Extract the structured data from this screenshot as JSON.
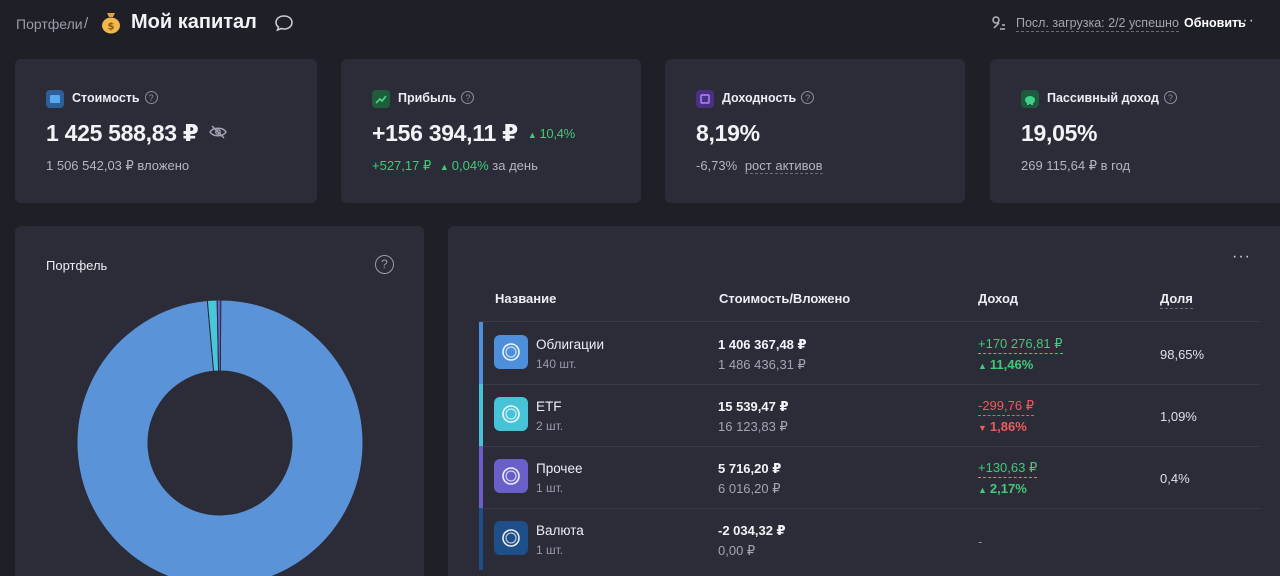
{
  "header": {
    "breadcrumb": "Портфели",
    "separator": "/",
    "title": "Мой капитал",
    "sync_status": "Посл. загрузка: 2/2 успешно",
    "refresh_label": "Обновить",
    "more": "···"
  },
  "cards": [
    {
      "label": "Стоимость",
      "value": "1 425 588,83 ₽",
      "sub": "1 506 542,03 ₽ вложено",
      "icon": "wallet-icon",
      "color": "#3d8de0"
    },
    {
      "label": "Прибыль",
      "value": "+156 394,11 ₽",
      "change_pct": "10,4%",
      "sub_amount": "+527,17 ₽",
      "sub_pct": "0,04%",
      "sub_suffix": "за день",
      "icon": "chart-line-icon",
      "color": "#2f8f5b"
    },
    {
      "label": "Доходность",
      "value": "8,19%",
      "sub_pct": "-6,73%",
      "sub_link": "рост активов",
      "icon": "calendar-icon",
      "color": "#7b52c9"
    },
    {
      "label": "Пассивный доход",
      "value": "19,05%",
      "sub": "269 115,64 ₽ в год",
      "icon": "piggy-bank-icon",
      "color": "#2a9d6a"
    }
  ],
  "portfolio": {
    "title": "Портфель",
    "help": "?"
  },
  "chart_data": {
    "type": "pie",
    "donut": true,
    "categories": [
      "Облигации",
      "ETF",
      "Прочее",
      "Валюта"
    ],
    "values": [
      98.65,
      1.09,
      0.4,
      0
    ],
    "colors": [
      "#5b93d8",
      "#48c6da",
      "#6a5fc9",
      "#1f4f88"
    ]
  },
  "table": {
    "headers": {
      "name": "Название",
      "value": "Стоимость/Вложено",
      "income": "Доход",
      "share": "Доля"
    },
    "more": "···",
    "rows": [
      {
        "name": "Облигации",
        "qty": "140 шт.",
        "value": "1 406 367,48 ₽",
        "invested": "1 486 436,31 ₽",
        "income": "+170 276,81 ₽",
        "income_pct": "11,46%",
        "trend": "up",
        "share": "98,65%",
        "color": "#4e8fdc"
      },
      {
        "name": "ETF",
        "qty": "2 шт.",
        "value": "15 539,47 ₽",
        "invested": "16 123,83 ₽",
        "income": "-299,76 ₽",
        "income_pct": "1,86%",
        "trend": "down",
        "share": "1,09%",
        "color": "#46c3d6"
      },
      {
        "name": "Прочее",
        "qty": "1 шт.",
        "value": "5 716,20 ₽",
        "invested": "6 016,20 ₽",
        "income": "+130,63 ₽",
        "income_pct": "2,17%",
        "trend": "up",
        "share": "0,4%",
        "color": "#6a5fc9"
      },
      {
        "name": "Валюта",
        "qty": "1 шт.",
        "value": "-2 034,32 ₽",
        "invested": "0,00 ₽",
        "income": "-",
        "share": "",
        "color": "#1f4f88"
      }
    ]
  }
}
